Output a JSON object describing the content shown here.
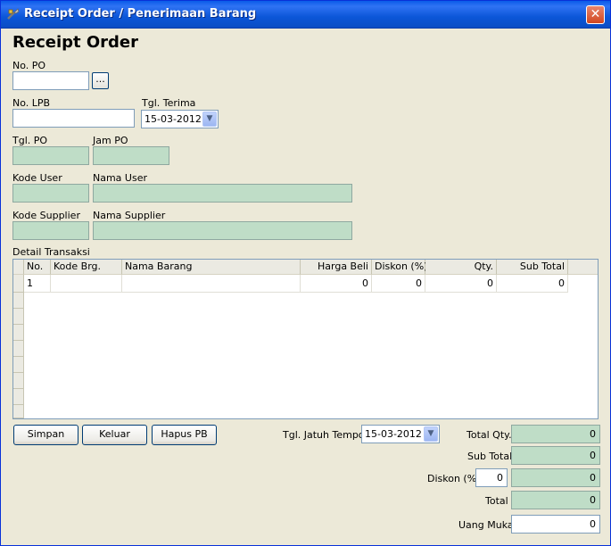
{
  "window": {
    "title": "Receipt Order / Penerimaan Barang",
    "close_glyph": "✕"
  },
  "heading": "Receipt Order",
  "fields": {
    "no_po": {
      "label": "No. PO",
      "value": "",
      "browse_label": "..."
    },
    "no_lpb": {
      "label": "No. LPB",
      "value": ""
    },
    "tgl_terima": {
      "label": "Tgl. Terima",
      "value": "15-03-2012"
    },
    "tgl_po": {
      "label": "Tgl. PO",
      "value": ""
    },
    "jam_po": {
      "label": "Jam PO",
      "value": ""
    },
    "kode_user": {
      "label": "Kode User",
      "value": ""
    },
    "nama_user": {
      "label": "Nama User",
      "value": ""
    },
    "kode_supplier": {
      "label": "Kode Supplier",
      "value": ""
    },
    "nama_supplier": {
      "label": "Nama Supplier",
      "value": ""
    }
  },
  "detail": {
    "label": "Detail Transaksi",
    "columns": [
      "No.",
      "Kode Brg.",
      "Nama Barang",
      "Harga Beli",
      "Diskon (%)",
      "Qty.",
      "Sub Total"
    ],
    "rows": [
      {
        "no": "1",
        "kode": "",
        "nama": "",
        "harga": "0",
        "diskon": "0",
        "qty": "0",
        "subtotal": "0"
      }
    ]
  },
  "buttons": {
    "simpan": "Simpan",
    "keluar": "Keluar",
    "hapus": "Hapus PB"
  },
  "jatuh_tempo": {
    "label": "Tgl. Jatuh Tempo",
    "value": "15-03-2012"
  },
  "totals": {
    "total_qty": {
      "label": "Total Qty.",
      "value": "0"
    },
    "sub_total": {
      "label": "Sub Total",
      "value": "0"
    },
    "diskon": {
      "label": "Diskon (%)",
      "percent": "0",
      "value": "0"
    },
    "total": {
      "label": "Total",
      "value": "0"
    },
    "uang_muka": {
      "label": "Uang Muka",
      "value": "0"
    }
  },
  "icons": {
    "window": "app-tools-icon",
    "close": "close-icon",
    "dropdown": "chevron-down-icon"
  },
  "colors": {
    "title_bar": "#0A5BE8",
    "readonly_field": "#BFDDC7",
    "window_bg": "#ECE9D8"
  }
}
